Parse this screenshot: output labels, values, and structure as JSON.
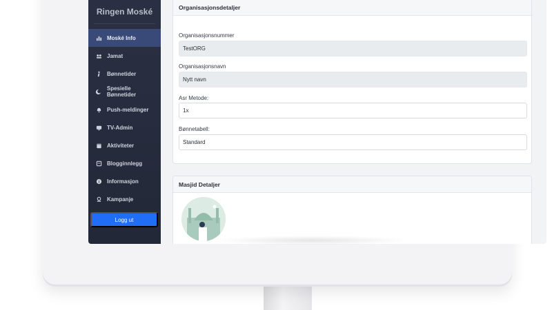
{
  "sidebar": {
    "brand": "Ringen Moské",
    "items": [
      {
        "label": "Moské Info",
        "icon": "chart-icon",
        "active": true
      },
      {
        "label": "Jamat",
        "icon": "people-icon",
        "active": false
      },
      {
        "label": "Bønnetider",
        "icon": "person-pray-icon",
        "active": false
      },
      {
        "label": "Spesielle Bønnetider",
        "icon": "moon-icon",
        "active": false
      },
      {
        "label": "Push-meldinger",
        "icon": "bell-icon",
        "active": false
      },
      {
        "label": "TV-Admin",
        "icon": "tv-icon",
        "active": false
      },
      {
        "label": "Aktiviteter",
        "icon": "calendar-icon",
        "active": false
      },
      {
        "label": "Blogginnlegg",
        "icon": "blog-icon",
        "active": false
      },
      {
        "label": "Informasjon",
        "icon": "info-icon",
        "active": false
      },
      {
        "label": "Kampanje",
        "icon": "campaign-icon",
        "active": false
      }
    ],
    "logout_label": "Logg ut"
  },
  "org_card": {
    "title": "Organisasjonsdetaljer",
    "org_number_label": "Organisasjonsnummer",
    "org_number_value": "TestORG",
    "org_name_label": "Organisasjonsnavn",
    "org_name_value": "Nytt navn",
    "asr_label": "Asr Metode:",
    "asr_value": "1x",
    "prayer_table_label": "Bønnetabell:",
    "prayer_table_value": "Standard"
  },
  "masjid_card": {
    "title": "Masjid Detaljer"
  },
  "colors": {
    "sidebar_bg": "#262b3c",
    "active_item": "#3a4a78",
    "logout_button": "#1f6ef5"
  }
}
